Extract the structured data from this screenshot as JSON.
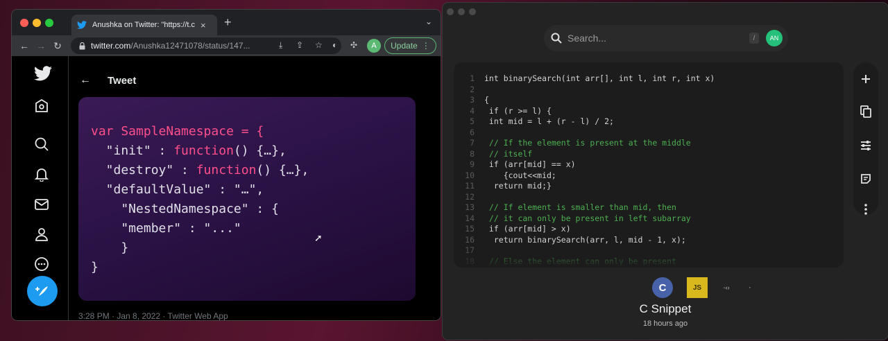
{
  "browser": {
    "tab_title": "Anushka on Twitter: \"https://t.c",
    "tab_close": "×",
    "new_tab": "+",
    "url_host": "twitter.com",
    "url_path": "/Anushka12471078/status/147...",
    "profile_initial": "A",
    "update_label": "Update"
  },
  "twitter": {
    "page_title": "Tweet",
    "code_lines": [
      {
        "kw": "var SampleNamespace",
        "rest": " = {"
      },
      {
        "pre": "  \"init\" : ",
        "kw": "function",
        "rest": "() {…},"
      },
      {
        "pre": "  \"destroy\" : ",
        "kw": "function",
        "rest": "() {…},"
      },
      {
        "pre": "  \"defaultValue\" : \"…\","
      },
      {
        "pre": "    \"NestedNamespace\" : {"
      },
      {
        "pre": "    \"member\" : \"...\""
      },
      {
        "pre": "    }"
      },
      {
        "pre": "}"
      }
    ],
    "meta": "3:28 PM · Jan 8, 2022 · Twitter Web App"
  },
  "snippet_app": {
    "search_placeholder": "Search...",
    "search_shortcut": "/",
    "user_initials": "AN",
    "code": [
      {
        "n": "1",
        "t": "int binarySearch(int arr[], int l, int r, int x)",
        "c": ""
      },
      {
        "n": "2",
        "t": "",
        "c": ""
      },
      {
        "n": "3",
        "t": "{",
        "c": ""
      },
      {
        "n": "4",
        "t": " if (r >= l) {",
        "c": ""
      },
      {
        "n": "5",
        "t": " int mid = l + (r - l) / 2;",
        "c": ""
      },
      {
        "n": "6",
        "t": "",
        "c": ""
      },
      {
        "n": "7",
        "t": " // If the element is present at the middle",
        "c": "comment"
      },
      {
        "n": "8",
        "t": " // itself",
        "c": "comment"
      },
      {
        "n": "9",
        "t": " if (arr[mid] == x)",
        "c": ""
      },
      {
        "n": "10",
        "t": "    {cout<<mid;",
        "c": ""
      },
      {
        "n": "11",
        "t": "  return mid;}",
        "c": ""
      },
      {
        "n": "12",
        "t": "",
        "c": ""
      },
      {
        "n": "13",
        "t": " // If element is smaller than mid, then",
        "c": "comment"
      },
      {
        "n": "14",
        "t": " // it can only be present in left subarray",
        "c": "comment"
      },
      {
        "n": "15",
        "t": " if (arr[mid] > x)",
        "c": ""
      },
      {
        "n": "16",
        "t": "  return binarySearch(arr, l, mid - 1, x);",
        "c": ""
      },
      {
        "n": "17",
        "t": "",
        "c": ""
      },
      {
        "n": "18",
        "t": " // Else the element can only be present",
        "c": "comment"
      }
    ],
    "languages": [
      "C",
      "JS"
    ],
    "snippet_title": "C Snippet",
    "snippet_time": "18 hours ago"
  }
}
